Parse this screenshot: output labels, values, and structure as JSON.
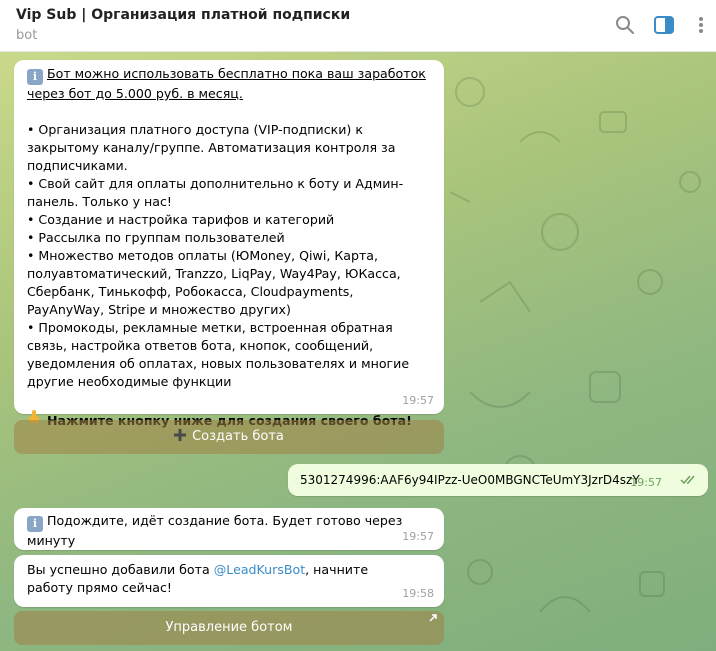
{
  "header": {
    "title": "Vip Sub | Организация платной подписки",
    "subtitle": "bot"
  },
  "messages": {
    "intro": {
      "info_line": "Бот можно использовать бесплатно пока ваш заработок через бот до 5.000 руб. в месяц.",
      "bullets": [
        "• Организация платного доступа (VIP-подписки) к закрытому каналу/группе. Автоматизация контроля за подписчиками.",
        "• Свой сайт для оплаты дополнительно к боту и Админ-панель. Только у нас!",
        "• Создание и настройка тарифов и категорий",
        "• Рассылка по группам пользователей",
        "• Множество методов оплаты (ЮMoney, Qiwi, Карта, полуавтоматический, Tranzzo, LiqPay, Way4Pay, ЮКасса, Сбербанк, Тинькофф, Робокасса, Cloudpayments, PayAnyWay, Stripe и множество других)",
        "• Промокоды, рекламные метки, встроенная обратная связь, настройка ответов бота, кнопок, сообщений, уведомления об оплатах, новых пользователях и многие другие необходимые функции"
      ],
      "cta": "Нажмите кнопку ниже для создания своего бота!",
      "time": "19:57"
    },
    "create_button": "Создать бота",
    "outgoing": {
      "text": "5301274996:AAF6y94IPzz-UeO0MBGNCTeUmY3JzrD4szY",
      "time": "19:57"
    },
    "wait": {
      "text": "Подождите, идёт создание бота. Будет готово через минуту",
      "time": "19:57"
    },
    "success": {
      "before": "Вы успешно добавили бота ",
      "bot_link": "@LeadKursBot",
      "after": ", начните работу прямо сейчас!",
      "time": "19:58"
    },
    "manage_button": "Управление ботом"
  },
  "icons": {
    "search": "search-icon",
    "sidebar": "sidebar-toggle-icon",
    "more": "more-vertical-icon",
    "info": "info-icon",
    "pointing": "pointing-down-icon",
    "plus": "plus-icon",
    "external": "external-link-icon",
    "read_checks": "double-check-icon"
  },
  "colors": {
    "accent": "#3a8cc9",
    "outgoing_bubble": "#effdde",
    "keyboard_button": "#a8844a"
  }
}
